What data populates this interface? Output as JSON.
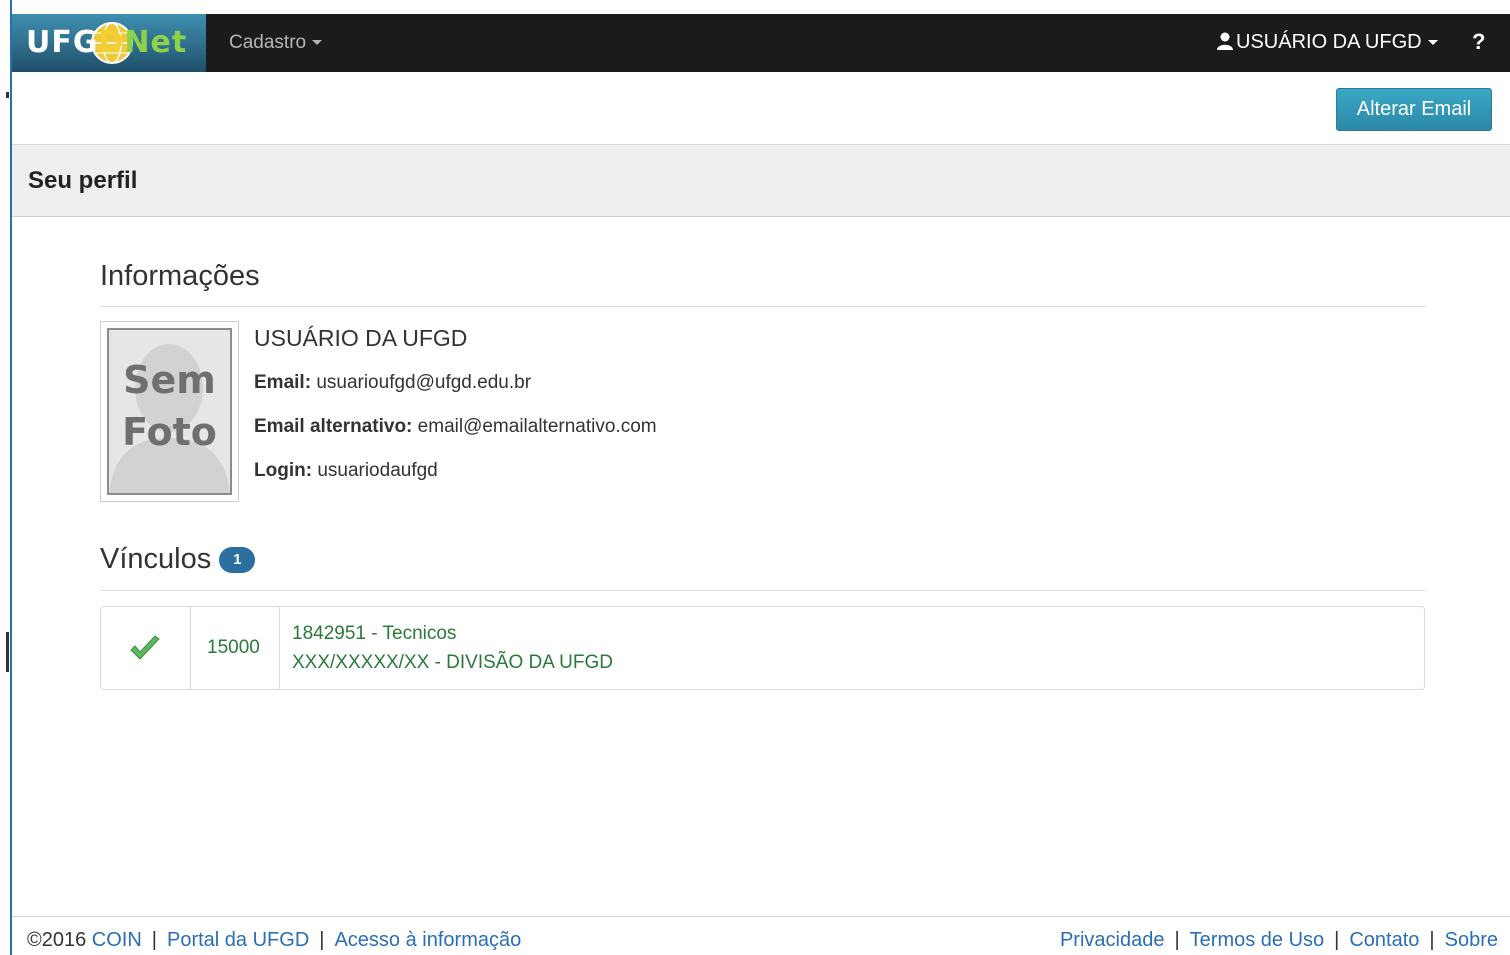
{
  "navbar": {
    "brand": {
      "part1": "UFG",
      "part2": "D",
      "part3": "Net"
    },
    "menu_cadastro": "Cadastro",
    "user_name": "USUÁRIO DA UFGD",
    "help_label": "?"
  },
  "actions": {
    "alterar_email": "Alterar Email"
  },
  "page": {
    "title": "Seu perfil"
  },
  "informacoes": {
    "heading": "Informações",
    "photo_text_line1": "Sem",
    "photo_text_line2": "Foto",
    "name": "USUÁRIO DA UFGD",
    "email_label": "Email:",
    "email_value": "usuarioufgd@ufgd.edu.br",
    "alt_email_label": "Email alternativo:",
    "alt_email_value": "email@emailalternativo.com",
    "login_label": "Login:",
    "login_value": "usuariodaufgd"
  },
  "vinculos": {
    "heading": "Vínculos",
    "count": "1",
    "rows": [
      {
        "status_icon": "check-icon",
        "code": "15000",
        "line1": "1842951 - Tecnicos",
        "line2": "XXX/XXXXX/XX - DIVISÃO DA UFGD"
      }
    ]
  },
  "footer": {
    "copyright": "©2016",
    "coin": "COIN",
    "portal": "Portal da UFGD",
    "acesso": "Acesso à informação",
    "privacidade": "Privacidade",
    "termos": "Termos de Uso",
    "contato": "Contato",
    "sobre": "Sobre",
    "separator": "|"
  },
  "colors": {
    "navbar_bg": "#1b1b1b",
    "primary_button": "#2f96b4",
    "link": "#2a6fb5",
    "badge": "#2a6fa0",
    "vinculo_text": "#2a7a3b",
    "check": "#5cb85c"
  }
}
